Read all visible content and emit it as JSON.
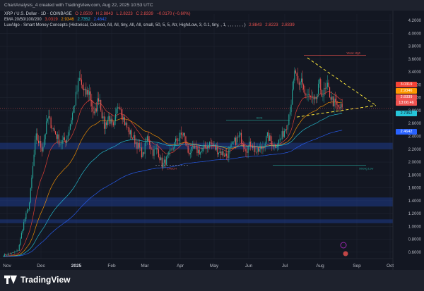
{
  "header": {
    "title": "ChartAnalysis_4 created with TradingView.com, Aug 22, 2025 10:53 UTC"
  },
  "legend": {
    "symbol": {
      "text": "XRP / U.S. Dollar · 1D · COINBASE",
      "o": "O 2.8509",
      "h": "H 2.8843",
      "l": "L 2.8223",
      "c": "C 2.8339",
      "chg": "−0.0170 (−0.60%)"
    },
    "ema": {
      "text": "EMA 20/50/100/200",
      "v1": "3.0319",
      "v2": "2.9346",
      "v3": "2.7352",
      "v4": "2.4642"
    },
    "lux": {
      "text": "LuxAlgo - Smart Money Concepts (Historical, Colored, All, All, tiny, All, All, small, 50, 5, 5, Atr, High/Low, 3, 0.1, tiny, , 1, , , , , , , , )",
      "v1": "2.8843",
      "v2": "2.8223",
      "v3": "2.8339"
    }
  },
  "colors": {
    "up": "#26a69a",
    "down": "#ef5350",
    "ema20": "#f44336",
    "ema50": "#ff9800",
    "ema100": "#26c6da",
    "ema200": "#2962ff",
    "triangle": "#ffeb3b",
    "zone": "#1e3a8a"
  },
  "chart_data": {
    "type": "candlestick",
    "x_labels": [
      "Nov",
      "Dec",
      "2025",
      "Feb",
      "Mar",
      "Apr",
      "May",
      "Jun",
      "Jul",
      "Aug",
      "Sep",
      "Oct"
    ],
    "y_ticks": [
      "4.2000",
      "4.0000",
      "3.8000",
      "3.6000",
      "3.4000",
      "3.2000",
      "3.0000",
      "2.8000",
      "2.6000",
      "2.4000",
      "2.2000",
      "2.0000",
      "1.8000",
      "1.6000",
      "1.4000",
      "1.2000",
      "1.0000",
      "0.8000",
      "0.6000"
    ],
    "ylim": [
      0.5,
      4.3
    ],
    "close_path": [
      [
        0,
        0.55
      ],
      [
        10,
        0.58
      ],
      [
        18,
        0.62
      ],
      [
        25,
        1.05
      ],
      [
        32,
        1.35
      ],
      [
        40,
        2.4
      ],
      [
        48,
        2.2
      ],
      [
        55,
        2.7
      ],
      [
        62,
        2.5
      ],
      [
        70,
        2.3
      ],
      [
        78,
        2.35
      ],
      [
        86,
        2.8
      ],
      [
        94,
        3.3
      ],
      [
        100,
        3.05
      ],
      [
        106,
        3.1
      ],
      [
        112,
        2.7
      ],
      [
        118,
        3.05
      ],
      [
        124,
        2.55
      ],
      [
        130,
        2.7
      ],
      [
        136,
        2.5
      ],
      [
        142,
        2.95
      ],
      [
        150,
        2.6
      ],
      [
        156,
        2.45
      ],
      [
        164,
        2.3
      ],
      [
        172,
        2.1
      ],
      [
        178,
        2.4
      ],
      [
        184,
        2.15
      ],
      [
        190,
        2.2
      ],
      [
        196,
        1.95
      ],
      [
        202,
        2.05
      ],
      [
        208,
        2.2
      ],
      [
        214,
        2.35
      ],
      [
        222,
        2.45
      ],
      [
        228,
        2.15
      ],
      [
        236,
        2.2
      ],
      [
        244,
        2.15
      ],
      [
        250,
        2.25
      ],
      [
        256,
        2.3
      ],
      [
        262,
        2.2
      ],
      [
        268,
        2.15
      ],
      [
        276,
        2.1
      ],
      [
        284,
        2.3
      ],
      [
        292,
        2.4
      ],
      [
        300,
        2.2
      ],
      [
        306,
        2.3
      ],
      [
        312,
        2.15
      ],
      [
        318,
        2.2
      ],
      [
        326,
        2.4
      ],
      [
        334,
        2.25
      ],
      [
        342,
        2.35
      ],
      [
        350,
        2.6
      ],
      [
        356,
        3.0
      ],
      [
        360,
        3.45
      ],
      [
        364,
        3.1
      ],
      [
        368,
        3.3
      ],
      [
        372,
        3.05
      ],
      [
        378,
        3.0
      ],
      [
        384,
        2.9
      ],
      [
        390,
        3.2
      ],
      [
        394,
        3.05
      ],
      [
        400,
        3.15
      ],
      [
        406,
        2.95
      ],
      [
        412,
        2.85
      ],
      [
        418,
        2.84
      ]
    ],
    "ema20": "3.0319",
    "ema50": "2.9346",
    "ema100": "2.7352",
    "ema200": "2.4642",
    "last_price": "2.8339",
    "countdown": "13:06:46",
    "zones": [
      {
        "lo": 2.2,
        "hi": 2.3
      },
      {
        "lo": 1.31,
        "hi": 1.45
      },
      {
        "lo": 1.05,
        "hi": 1.11
      }
    ],
    "annotations": [
      {
        "text": "Weak High"
      },
      {
        "text": "Strong Low"
      },
      {
        "text": "BOS"
      },
      {
        "text": "CHoCH"
      }
    ]
  }
}
